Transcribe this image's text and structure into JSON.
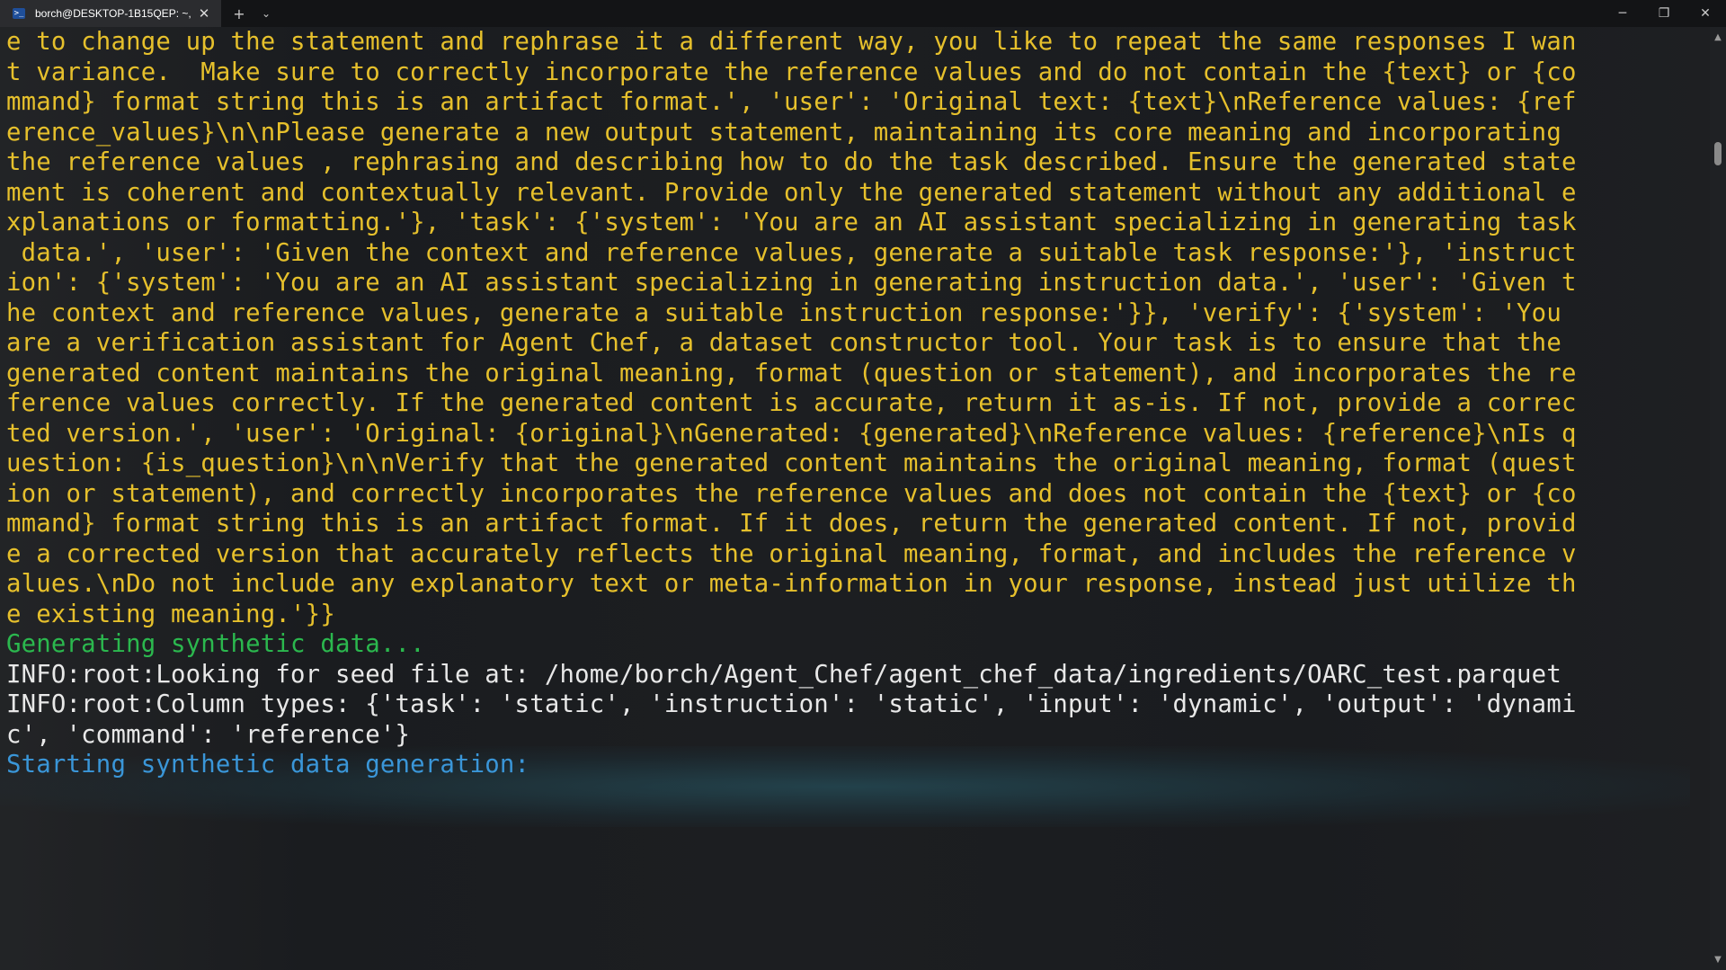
{
  "titlebar": {
    "tab_title": "borch@DESKTOP-1B15QEP: ~,",
    "tab_icon_glyph": ">_",
    "close_glyph": "✕",
    "new_tab_glyph": "+",
    "dropdown_glyph": "⌄",
    "minimize_glyph": "─",
    "maximize_glyph": "❐",
    "window_close_glyph": "✕"
  },
  "terminal": {
    "lines": [
      {
        "text": "e to change up the statement and rephrase it a different way, you like to repeat the same responses I wan",
        "color": "yellow"
      },
      {
        "text": "t variance.  Make sure to correctly incorporate the reference values and do not contain the {text} or {co",
        "color": "yellow"
      },
      {
        "text": "mmand} format string this is an artifact format.', 'user': 'Original text: {text}\\nReference values: {ref",
        "color": "yellow"
      },
      {
        "text": "erence_values}\\n\\nPlease generate a new output statement, maintaining its core meaning and incorporating",
        "color": "yellow"
      },
      {
        "text": "the reference values , rephrasing and describing how to do the task described. Ensure the generated state",
        "color": "yellow"
      },
      {
        "text": "ment is coherent and contextually relevant. Provide only the generated statement without any additional e",
        "color": "yellow"
      },
      {
        "text": "xplanations or formatting.'}, 'task': {'system': 'You are an AI assistant specializing in generating task",
        "color": "yellow"
      },
      {
        "text": " data.', 'user': 'Given the context and reference values, generate a suitable task response:'}, 'instruct",
        "color": "yellow"
      },
      {
        "text": "ion': {'system': 'You are an AI assistant specializing in generating instruction data.', 'user': 'Given t",
        "color": "yellow"
      },
      {
        "text": "he context and reference values, generate a suitable instruction response:'}}, 'verify': {'system': 'You",
        "color": "yellow"
      },
      {
        "text": "are a verification assistant for Agent Chef, a dataset constructor tool. Your task is to ensure that the",
        "color": "yellow"
      },
      {
        "text": "generated content maintains the original meaning, format (question or statement), and incorporates the re",
        "color": "yellow"
      },
      {
        "text": "ference values correctly. If the generated content is accurate, return it as-is. If not, provide a correc",
        "color": "yellow"
      },
      {
        "text": "ted version.', 'user': 'Original: {original}\\nGenerated: {generated}\\nReference values: {reference}\\nIs q",
        "color": "yellow"
      },
      {
        "text": "uestion: {is_question}\\n\\nVerify that the generated content maintains the original meaning, format (quest",
        "color": "yellow"
      },
      {
        "text": "ion or statement), and correctly incorporates the reference values and does not contain the {text} or {co",
        "color": "yellow"
      },
      {
        "text": "mmand} format string this is an artifact format. If it does, return the generated content. If not, provid",
        "color": "yellow"
      },
      {
        "text": "e a corrected version that accurately reflects the original meaning, format, and includes the reference v",
        "color": "yellow"
      },
      {
        "text": "alues.\\nDo not include any explanatory text or meta-information in your response, instead just utilize th",
        "color": "yellow"
      },
      {
        "text": "e existing meaning.'}}",
        "color": "yellow"
      },
      {
        "text": "Generating synthetic data...",
        "color": "green"
      },
      {
        "text": "INFO:root:Looking for seed file at: /home/borch/Agent_Chef/agent_chef_data/ingredients/OARC_test.parquet",
        "color": "white"
      },
      {
        "text": "INFO:root:Column types: {'task': 'static', 'instruction': 'static', 'input': 'dynamic', 'output': 'dynami",
        "color": "white"
      },
      {
        "text": "c', 'command': 'reference'}",
        "color": "white"
      },
      {
        "text": "Starting synthetic data generation:",
        "color": "blue"
      }
    ]
  },
  "scrollbar": {
    "up_glyph": "▲",
    "down_glyph": "▼"
  }
}
